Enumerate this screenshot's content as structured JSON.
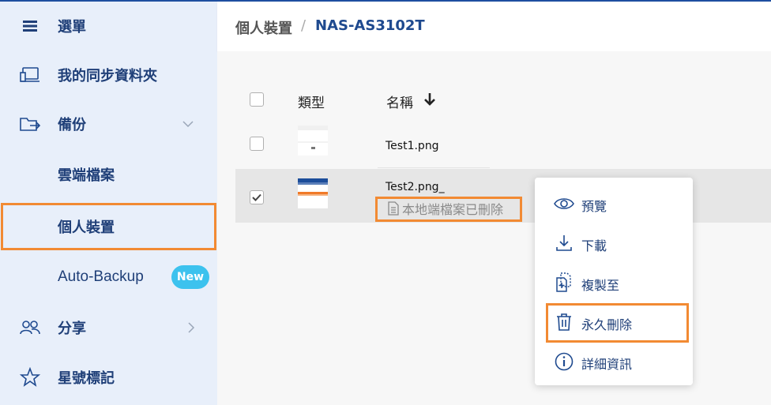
{
  "sidebar": {
    "items": [
      {
        "label": "選單",
        "icon": "menu-icon"
      },
      {
        "label": "我的同步資料夾",
        "icon": "laptop-icon"
      },
      {
        "label": "備份",
        "icon": "folder-arrow-icon"
      },
      {
        "label": "雲端檔案",
        "icon": ""
      },
      {
        "label": "個人裝置",
        "icon": ""
      },
      {
        "label": "Auto-Backup",
        "icon": "",
        "badge": "New"
      },
      {
        "label": "分享",
        "icon": "people-icon"
      },
      {
        "label": "星號標記",
        "icon": "star-icon"
      }
    ]
  },
  "header": {
    "breadcrumb_parent": "個人裝置",
    "breadcrumb_sep": "/",
    "breadcrumb_current": "NAS-AS3102T"
  },
  "table": {
    "col_type": "類型",
    "col_name": "名稱",
    "rows": [
      {
        "name": "Test1.png",
        "selected": false
      },
      {
        "name": "Test2.png_",
        "selected": true,
        "status": "本地端檔案已刪除"
      }
    ]
  },
  "context_menu": {
    "items": [
      {
        "label": "預覽",
        "icon": "eye-icon"
      },
      {
        "label": "下載",
        "icon": "download-icon"
      },
      {
        "label": "複製至",
        "icon": "copy-to-icon"
      },
      {
        "label": "永久刪除",
        "icon": "trash-icon"
      },
      {
        "label": "詳細資訊",
        "icon": "info-icon"
      }
    ]
  },
  "colors": {
    "accent": "#1f4a8f",
    "highlight": "#f28a33",
    "badge": "#3cc2ee"
  }
}
